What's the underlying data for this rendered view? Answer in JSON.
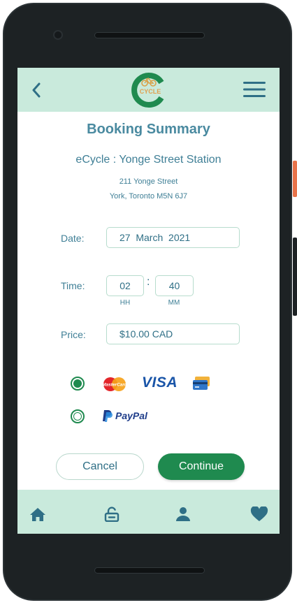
{
  "app": {
    "logo_text": "CYCLE",
    "colors": {
      "accent": "#2e8a57",
      "header_bg": "#c9eadc",
      "text": "#3f7f96"
    }
  },
  "header": {
    "back_icon": "chevron-left-icon",
    "menu_icon": "hamburger-menu-icon"
  },
  "page": {
    "title": "Booking Summary"
  },
  "station": {
    "name": "eCycle : Yonge Street Station",
    "address_line1": "211 Yonge Street",
    "address_line2": "York, Toronto M5N 6J7"
  },
  "form": {
    "date_label": "Date:",
    "date_value": "27  March  2021",
    "time_label": "Time:",
    "hours": "02",
    "separator": ":",
    "minutes": "40",
    "hours_caption": "HH",
    "minutes_caption": "MM",
    "price_label": "Price:",
    "price_value": "$10.00 CAD"
  },
  "payment": {
    "selected": "card",
    "card_option": {
      "mastercard_text": "MasterCard",
      "visa_text": "VISA",
      "card_icon": "credit-card-icon"
    },
    "paypal_option": {
      "text": "PayPal"
    }
  },
  "actions": {
    "cancel_label": "Cancel",
    "continue_label": "Continue"
  },
  "bottom_nav": {
    "items": [
      "home-icon",
      "unlock-icon",
      "person-icon",
      "heart-icon"
    ]
  }
}
